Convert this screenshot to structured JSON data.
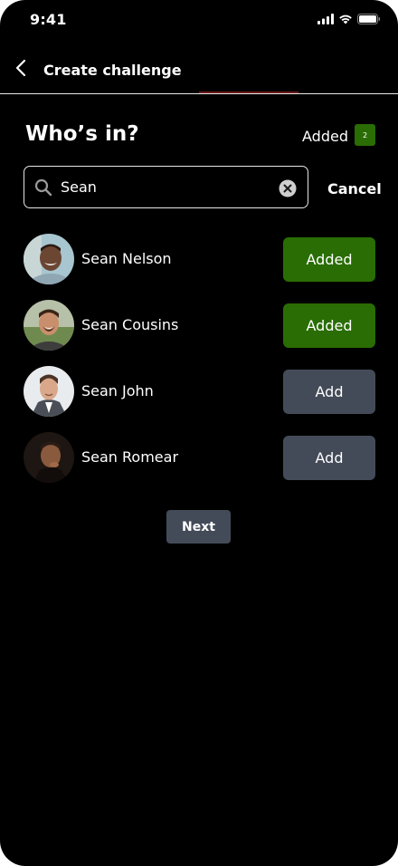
{
  "status_bar": {
    "time": "9:41",
    "icons": [
      "cellular-signal-icon",
      "wifi-icon",
      "battery-icon"
    ]
  },
  "nav": {
    "back_icon": "chevron-left-icon",
    "title": "Create challenge"
  },
  "header": {
    "title": "Who’s in?",
    "added_label": "Added",
    "added_count": "2"
  },
  "search": {
    "value": "Sean",
    "placeholder": "",
    "search_icon": "search-icon",
    "clear_icon": "clear-circle-icon",
    "cancel_label": "Cancel"
  },
  "people": [
    {
      "name": "Sean Nelson",
      "button_label": "Added",
      "state": "added"
    },
    {
      "name": "Sean Cousins",
      "button_label": "Added",
      "state": "added"
    },
    {
      "name": "Sean John",
      "button_label": "Add",
      "state": "add"
    },
    {
      "name": "Sean Romear",
      "button_label": "Add",
      "state": "add"
    }
  ],
  "next_label": "Next",
  "colors": {
    "background": "#000000",
    "added_green": "#2a6d04",
    "add_gray": "#444b58",
    "text": "#ffffff"
  }
}
